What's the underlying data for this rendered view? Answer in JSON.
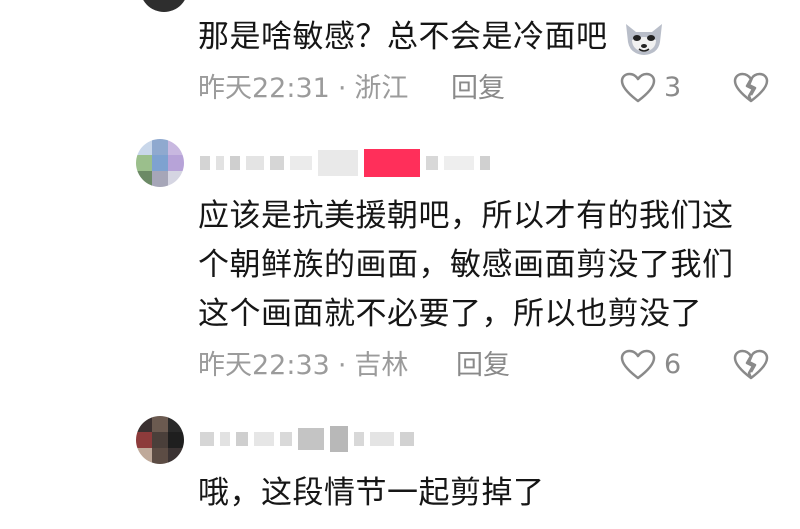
{
  "comments": [
    {
      "text": "那是啥敏感？总不会是冷面吧",
      "meta_time": "昨天22:31",
      "meta_sep": "·",
      "meta_location": "浙江",
      "reply_label": "回复",
      "like_count": "3"
    },
    {
      "lines": [
        "应该是抗美援朝吧，所以才有的我们这",
        "个朝鲜族的画面，敏感画面剪没了我们",
        "这个画面就不必要了，所以也剪没了"
      ],
      "meta_time": "昨天22:33",
      "meta_sep": "·",
      "meta_location": "吉林",
      "reply_label": "回复",
      "like_count": "6"
    },
    {
      "text": "哦，这段情节一起剪掉了"
    }
  ],
  "colors": {
    "accent_pink": "#ff2f5a",
    "meta_gray": "#9b9b9b",
    "text": "#161616"
  }
}
